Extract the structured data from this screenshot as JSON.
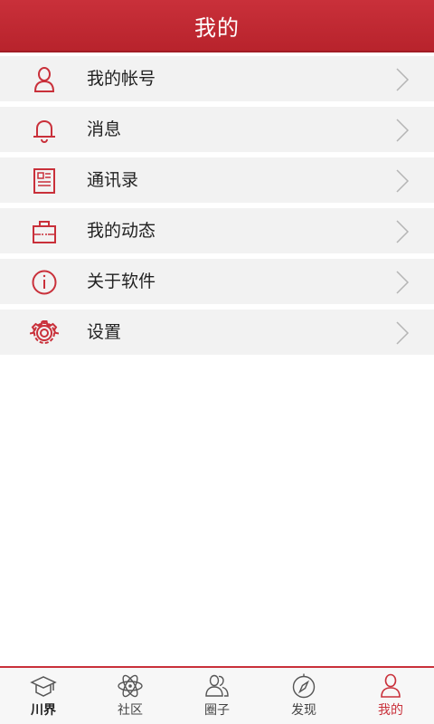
{
  "header": {
    "title": "我的"
  },
  "menu": {
    "items": [
      {
        "label": "我的帐号",
        "icon": "user-icon"
      },
      {
        "label": "消息",
        "icon": "bell-icon"
      },
      {
        "label": "通讯录",
        "icon": "contacts-book-icon"
      },
      {
        "label": "我的动态",
        "icon": "briefcase-icon"
      },
      {
        "label": "关于软件",
        "icon": "info-icon"
      },
      {
        "label": "设置",
        "icon": "gear-icon"
      }
    ]
  },
  "tabbar": {
    "tabs": [
      {
        "label": "川界",
        "icon": "graduation-cap-icon"
      },
      {
        "label": "社区",
        "icon": "atom-icon"
      },
      {
        "label": "圈子",
        "icon": "group-users-icon"
      },
      {
        "label": "发现",
        "icon": "compass-icon"
      },
      {
        "label": "我的",
        "icon": "user-icon",
        "active": true
      }
    ]
  },
  "colors": {
    "accent": "#c9303a",
    "row_bg": "#f2f2f2",
    "chevron": "#b5b5b5"
  }
}
